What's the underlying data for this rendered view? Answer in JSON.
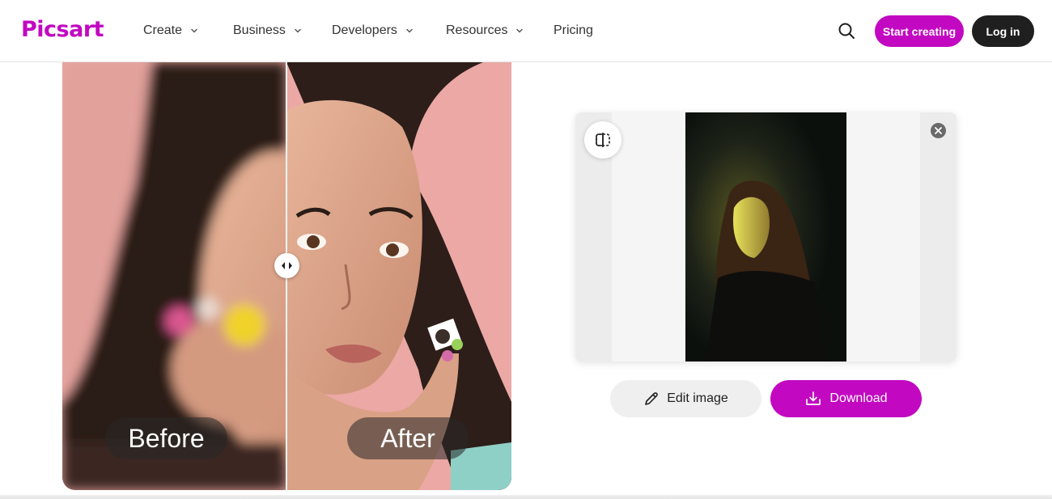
{
  "header": {
    "logo": "Picsart",
    "nav": [
      {
        "label": "Create",
        "dropdown": true
      },
      {
        "label": "Business",
        "dropdown": true
      },
      {
        "label": "Developers",
        "dropdown": true
      },
      {
        "label": "Resources",
        "dropdown": true
      },
      {
        "label": "Pricing",
        "dropdown": false
      }
    ],
    "search_icon": "search-icon",
    "start_label": "Start creating",
    "login_label": "Log in"
  },
  "comparison": {
    "before_label": "Before",
    "after_label": "After",
    "handle_icon": "split-arrows-icon"
  },
  "preview": {
    "toggle_icon": "compare-split-icon",
    "close_icon": "close-icon"
  },
  "actions": {
    "edit_label": "Edit image",
    "edit_icon": "pencil-icon",
    "download_label": "Download",
    "download_icon": "download-icon"
  },
  "colors": {
    "brand": "#c209c1",
    "dark_button": "#1f1f1f",
    "photo_background": "#e9a6a2"
  }
}
